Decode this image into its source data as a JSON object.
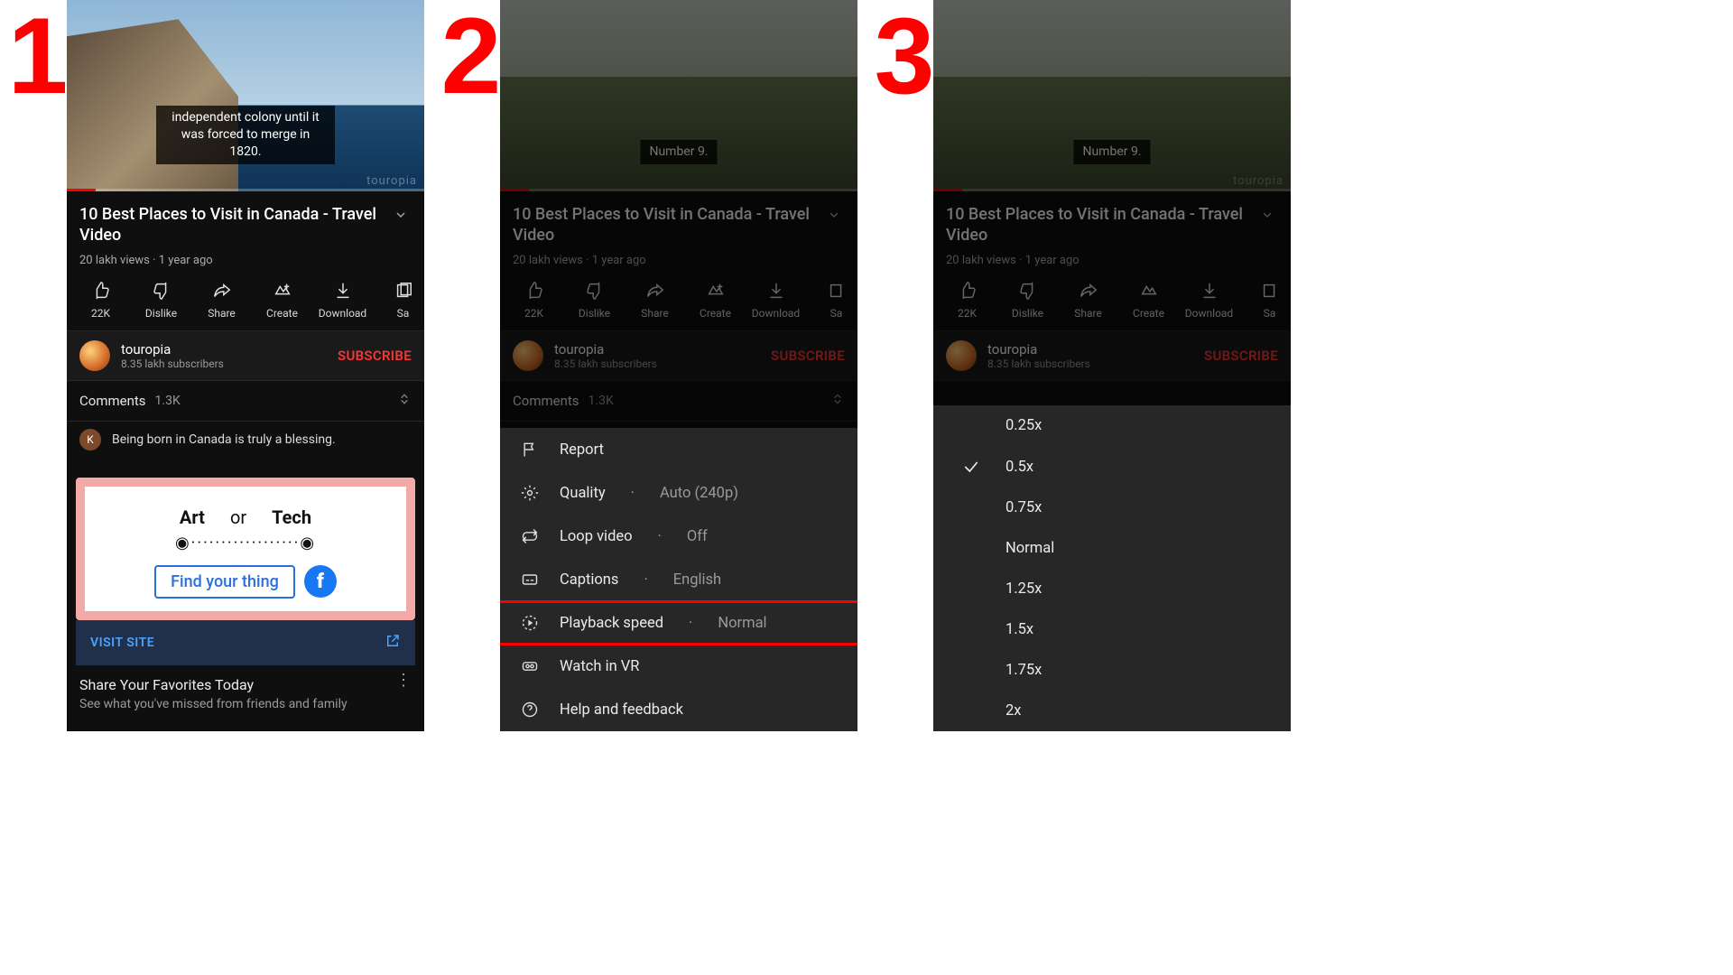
{
  "steps": {
    "one": "1",
    "two": "2",
    "three": "3"
  },
  "video": {
    "title": "10 Best Places to Visit in Canada - Travel Video",
    "views_age": "20 lakh views · 1 year ago",
    "caption_panel1": "independent colony until it was forced to merge in 1820.",
    "caption_panel23": "Number 9.",
    "watermark": "touropia"
  },
  "actions": {
    "like": "22K",
    "dislike": "Dislike",
    "share": "Share",
    "create": "Create",
    "download": "Download",
    "save": "Sa"
  },
  "channel": {
    "name": "touropia",
    "subs": "8.35 lakh subscribers",
    "subscribe": "SUBSCRIBE"
  },
  "comments": {
    "label": "Comments",
    "count": "1.3K",
    "avatar_letter": "K",
    "top_text": "Being born in Canada is truly a blessing."
  },
  "ad": {
    "word1": "Art",
    "or": "or",
    "word2": "Tech",
    "dots": "◉··················◉",
    "cta": "Find your thing",
    "fb_letter": "f",
    "visit": "VISIT SITE",
    "headline": "Share Your Favorites Today",
    "desc": "See what you've missed from friends and family"
  },
  "menu": {
    "report": "Report",
    "quality": "Quality",
    "quality_val": "Auto (240p)",
    "loop": "Loop video",
    "loop_val": "Off",
    "captions": "Captions",
    "captions_val": "English",
    "speed": "Playback speed",
    "speed_val": "Normal",
    "vr": "Watch in VR",
    "help": "Help and feedback",
    "sep": "·"
  },
  "speeds": {
    "s025": "0.25x",
    "s05": "0.5x",
    "s075": "0.75x",
    "normal": "Normal",
    "s125": "1.25x",
    "s15": "1.5x",
    "s175": "1.75x",
    "s2": "2x",
    "selected": "0.5x"
  }
}
